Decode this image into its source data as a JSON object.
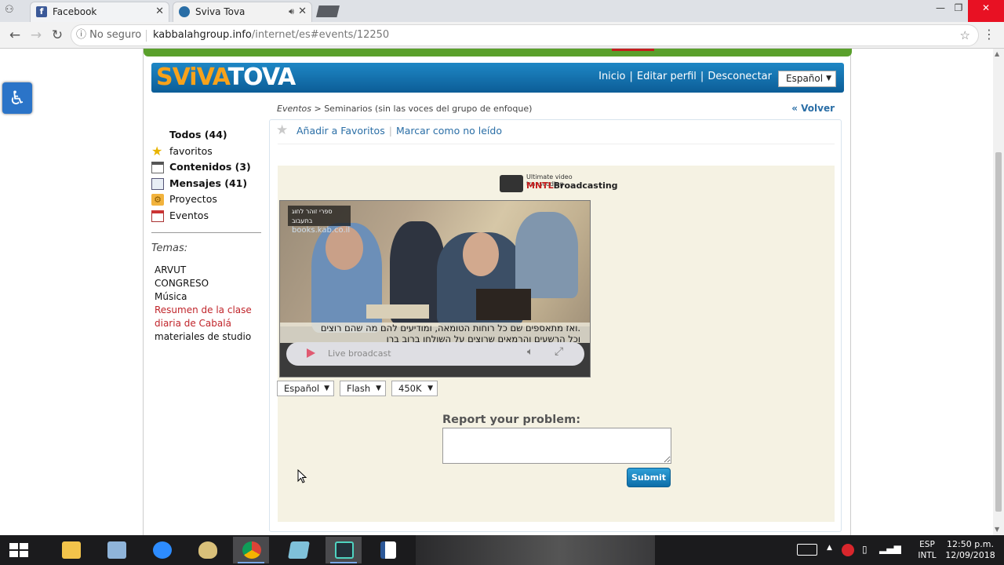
{
  "browser": {
    "tabs": [
      {
        "title": "Facebook",
        "color": "#3b5998"
      },
      {
        "title": "Sviva Tova",
        "color": "#2a6ea6"
      }
    ],
    "security_label": "No seguro",
    "url_domain": "kabbalahgroup.info",
    "url_path": "/internet/es#events/12250"
  },
  "site": {
    "logo_part1": "SViVA",
    "logo_part2": "TOVA",
    "nav": {
      "inicio": "Inicio",
      "editar": "Editar perfil",
      "desconectar": "Desconectar"
    },
    "language": "Español"
  },
  "breadcrumb": {
    "root": "Eventos",
    "separator": ">",
    "current": "Seminarios (sin las voces del grupo de enfoque)"
  },
  "back_link": "« Volver",
  "sidebar": {
    "items": [
      {
        "label": "Todos (44)",
        "bold": true,
        "icon": "none"
      },
      {
        "label": "favoritos",
        "bold": false,
        "icon": "star-icon"
      },
      {
        "label": "Contenidos (3)",
        "bold": true,
        "icon": "calendar-icon"
      },
      {
        "label": "Mensajes (41)",
        "bold": true,
        "icon": "envelope-icon"
      },
      {
        "label": "Proyectos",
        "bold": false,
        "icon": "gear-icon"
      },
      {
        "label": "Eventos",
        "bold": false,
        "icon": "calendar-events-icon"
      }
    ],
    "temas_label": "Temas:",
    "temas": [
      {
        "label": "ARVUT",
        "highlight": false
      },
      {
        "label": "CONGRESO",
        "highlight": false
      },
      {
        "label": "Música",
        "highlight": false
      },
      {
        "label": "Resumen de la clase",
        "highlight": true
      },
      {
        "label": "diaria de Cabalá",
        "highlight": true
      },
      {
        "label": "materiales de studio",
        "highlight": false
      }
    ]
  },
  "actions": {
    "add_favorite": "Añadir a Favoritos",
    "separator": "|",
    "mark_unread": "Marcar como no leído"
  },
  "player": {
    "brand_tagline": "Ultimate video transcoding",
    "brand_name_1": "MNTL",
    "brand_name_2": "Broadcasting",
    "watermark_line1": "ספרי זוהר לחוג בתעבוב",
    "watermark_line2": "books.kab.co.il",
    "subtitle_line1": "ואז מתאספים שם כל רוחות הטומאה, ומודיעים להם מה שהם רוצים.",
    "subtitle_line2": "וכל הרשעים והרמאים שרוצים על השולחן ברוב ברו",
    "status": "Live broadcast",
    "selects": {
      "language": "Español",
      "format": "Flash",
      "bitrate": "450K"
    }
  },
  "report": {
    "label": "Report your problem:",
    "textarea_value": "",
    "submit_label": "Submit"
  },
  "taskbar": {
    "lang_line1": "ESP",
    "lang_line2": "INTL",
    "time": "12:50 p.m.",
    "date": "12/09/2018"
  }
}
